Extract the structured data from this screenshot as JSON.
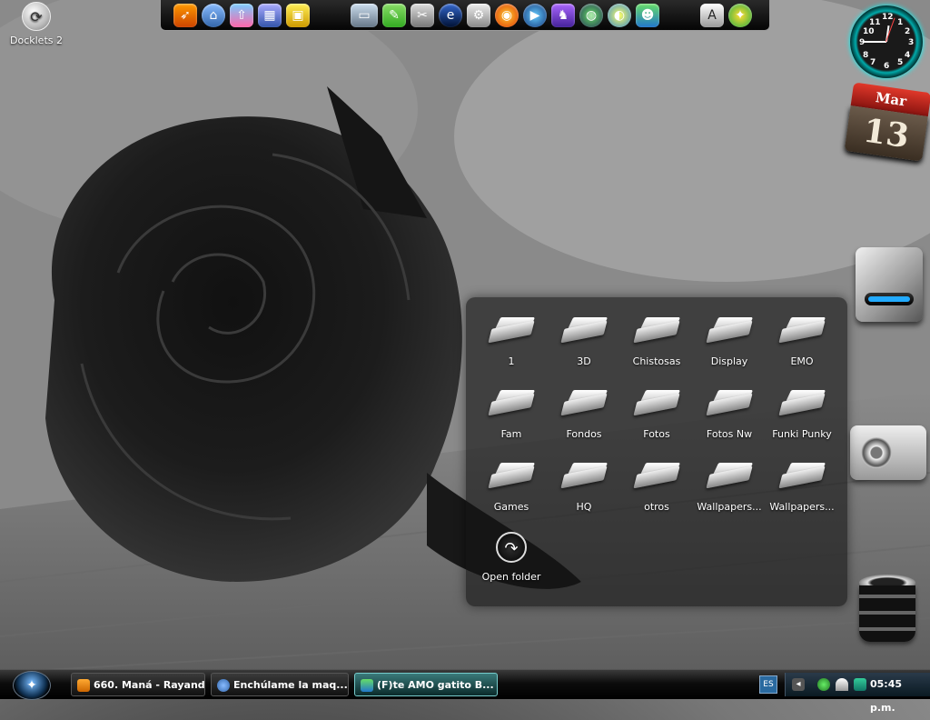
{
  "desktop": {
    "docklet_label": "Docklets 2"
  },
  "dock": {
    "icons": [
      "rocketdock-icon",
      "home-icon",
      "recycle-arrows-icon",
      "network-icon",
      "lock-icon",
      "id-card-icon",
      "writer-icon",
      "tools-icon",
      "ie-icon",
      "gear-printer-icon",
      "firefox-icon",
      "media-player-icon",
      "dragon-icon",
      "globe-icon",
      "video-icon",
      "messenger-icon",
      "adobe-icon",
      "world-icon"
    ]
  },
  "calendar": {
    "month": "Mar",
    "day": "13"
  },
  "stack": {
    "folders": [
      {
        "label": "1"
      },
      {
        "label": "3D"
      },
      {
        "label": "Chistosas"
      },
      {
        "label": "Display"
      },
      {
        "label": "EMO"
      },
      {
        "label": "Fam"
      },
      {
        "label": "Fondos"
      },
      {
        "label": "Fotos"
      },
      {
        "label": "Fotos Nw"
      },
      {
        "label": "Funki Punky"
      },
      {
        "label": "Games"
      },
      {
        "label": "HQ"
      },
      {
        "label": "otros"
      },
      {
        "label": "Wallpapers..."
      },
      {
        "label": "Wallpapers..."
      }
    ],
    "open_folder_label": "Open folder"
  },
  "taskbar": {
    "tasks": [
      {
        "label": "660. Maná - Rayand...",
        "active": false
      },
      {
        "label": "Enchúlame la maq...",
        "active": false
      },
      {
        "label": "(F)te AMO gatito B...",
        "active": true
      }
    ],
    "language": "ES",
    "time": "05:45 p.m."
  },
  "colors": {
    "accent_cyan": "#00cccc",
    "task_active": "#3a7a7a"
  }
}
